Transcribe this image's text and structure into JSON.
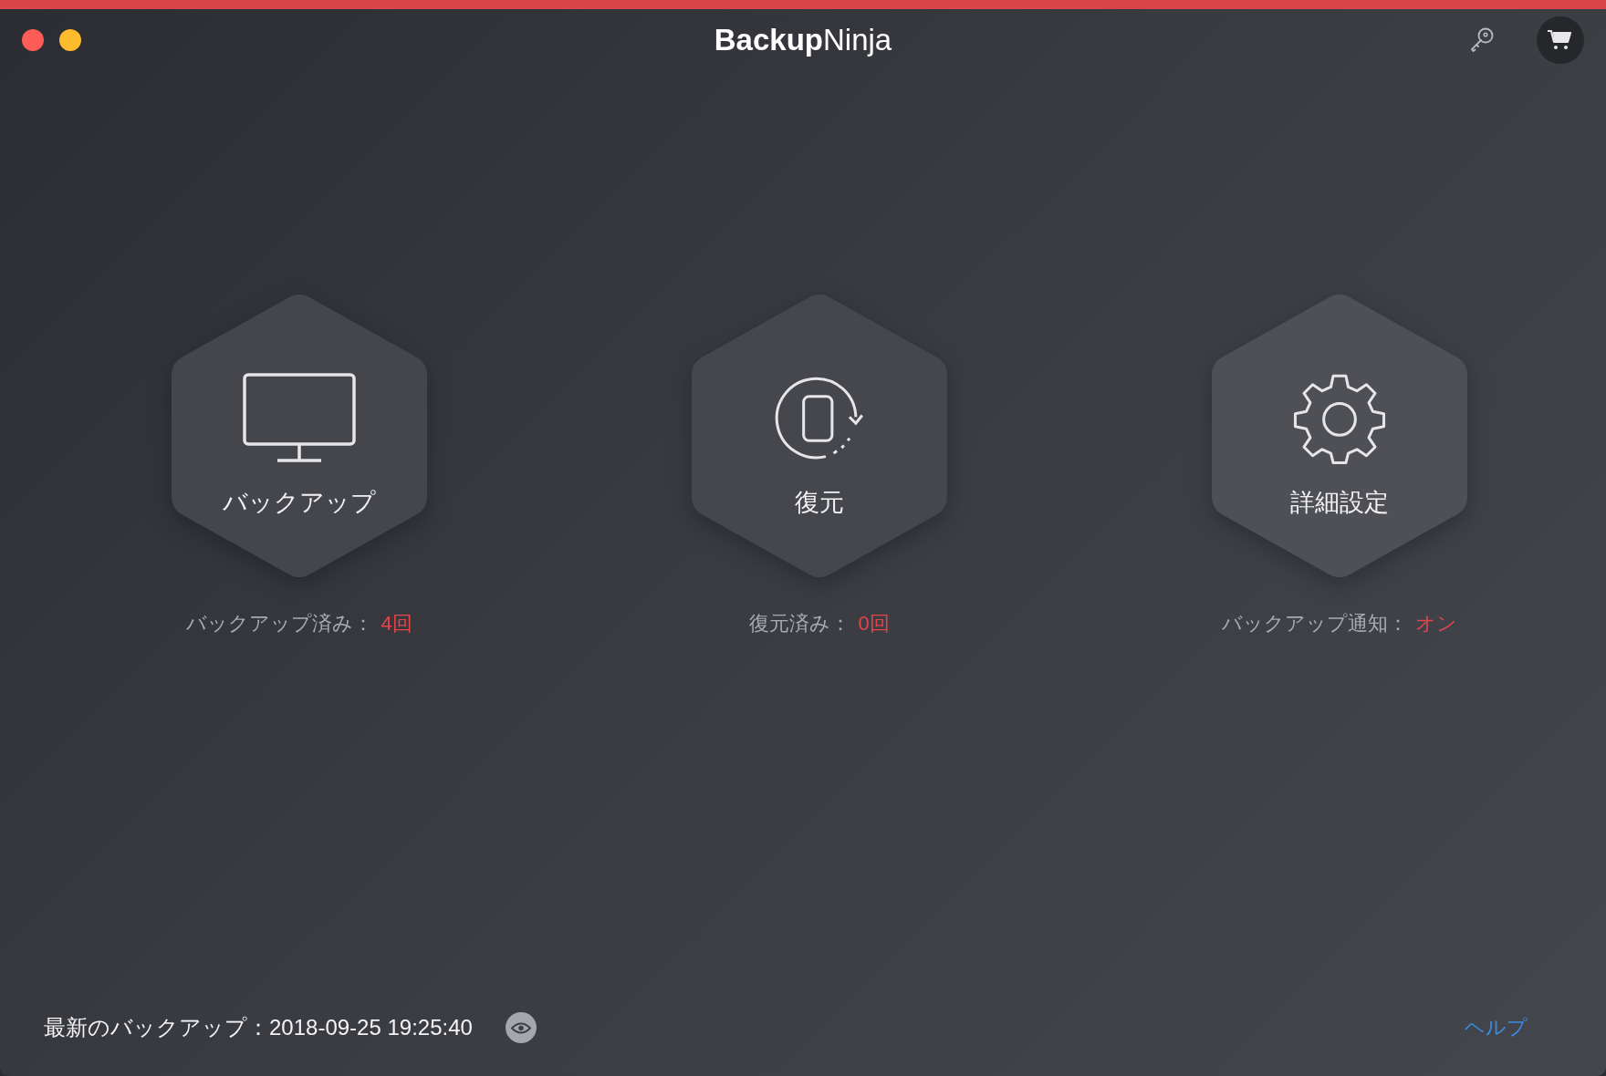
{
  "window": {
    "title": "**Backup**Ninja"
  },
  "tiles": [
    {
      "kind": "monitor",
      "label": "バックアップ",
      "stat_label": "バックアップ済み：",
      "stat_value": "4回"
    },
    {
      "kind": "restore",
      "label": "復元",
      "stat_label": "復元済み：",
      "stat_value": "0回"
    },
    {
      "kind": "gear",
      "label": "詳細設定",
      "stat_label": "バックアップ通知：",
      "stat_value": "オン"
    }
  ],
  "footer": {
    "last_backup": "最新のバックアップ：2018-09-25 19:25:40",
    "help": "ヘルプ"
  }
}
